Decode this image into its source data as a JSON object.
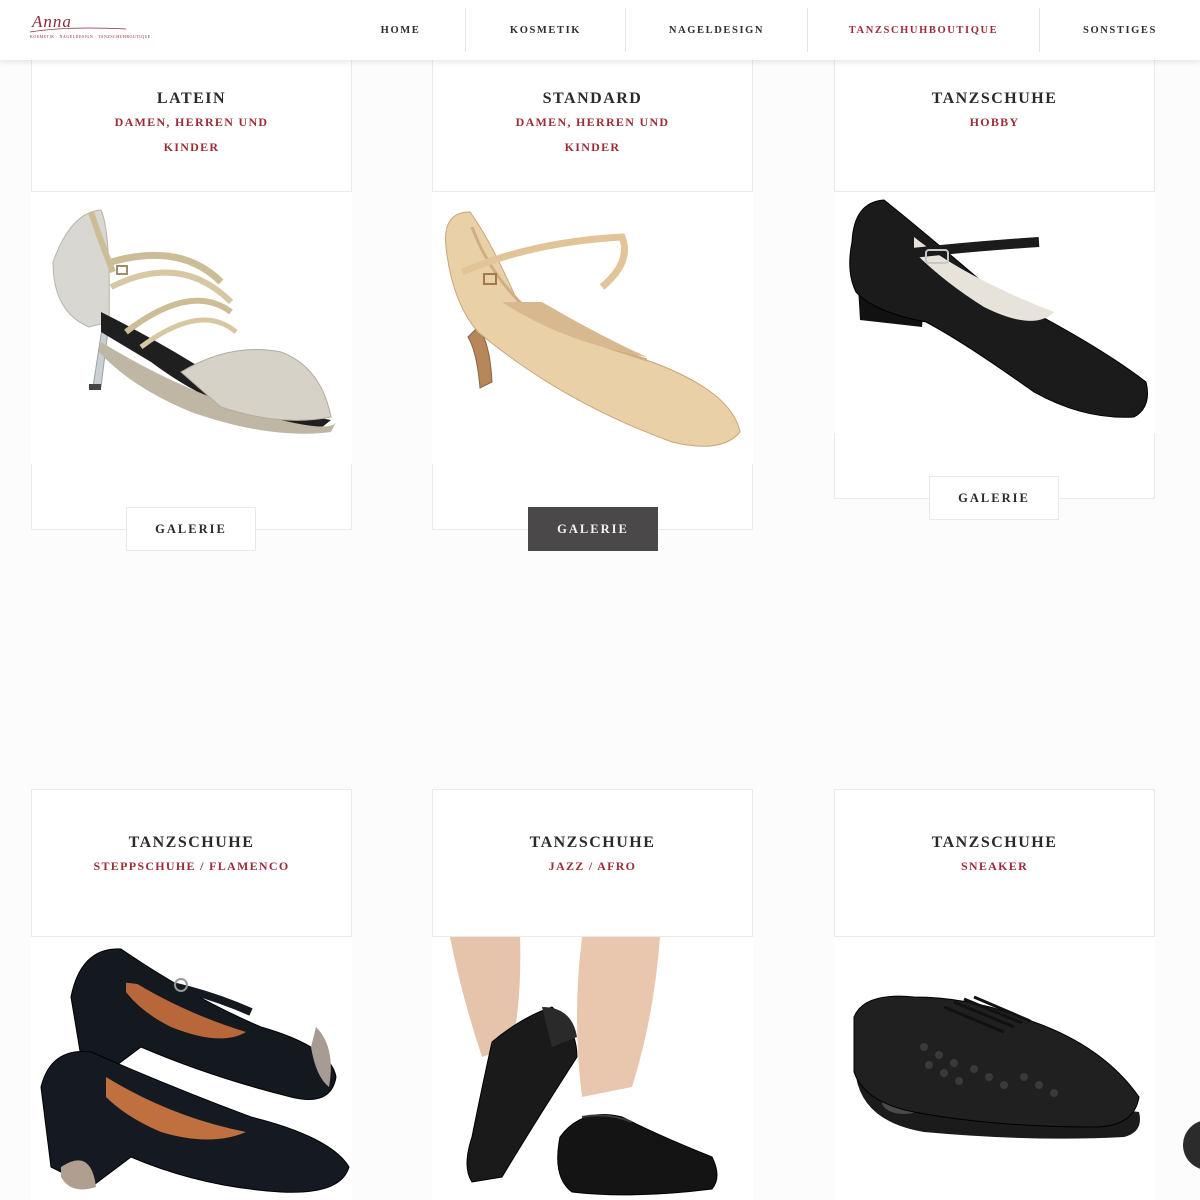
{
  "header": {
    "logo_text": "Anna",
    "logo_subtitle": "KOSMETIK · NAGELDESIGN · TANZSCHUHBOUTIQUE",
    "nav": [
      {
        "label": "HOME",
        "active": false
      },
      {
        "label": "KOSMETIK",
        "active": false
      },
      {
        "label": "NAGELDESIGN",
        "active": false
      },
      {
        "label": "TANZSCHUHBOUTIQUE",
        "active": true
      },
      {
        "label": "SONSTIGES",
        "active": false
      }
    ]
  },
  "cards": [
    {
      "title": "LATEIN",
      "subtitle": "DAMEN, HERREN UND KINDER",
      "button": "GALERIE",
      "image": "latin-sandal"
    },
    {
      "title": "STANDARD",
      "subtitle": "DAMEN, HERREN UND KINDER",
      "button": "GALERIE",
      "image": "standard-pump"
    },
    {
      "title": "TANZSCHUHE",
      "subtitle": "HOBBY",
      "button": "GALERIE",
      "image": "hobby-strap-shoe"
    },
    {
      "title": "TANZSCHUHE",
      "subtitle": "STEPPSCHUHE / FLAMENCO",
      "image": "flamenco-shoes"
    },
    {
      "title": "TANZSCHUHE",
      "subtitle": "JAZZ / AFRO",
      "image": "jazz-shoes"
    },
    {
      "title": "TANZSCHUHE",
      "subtitle": "SNEAKER",
      "image": "dance-sneaker"
    }
  ],
  "colors": {
    "accent": "#9b2c38",
    "text": "#2a2a2a",
    "button_hover": "#4a4849",
    "background": "#fdfcfc"
  }
}
